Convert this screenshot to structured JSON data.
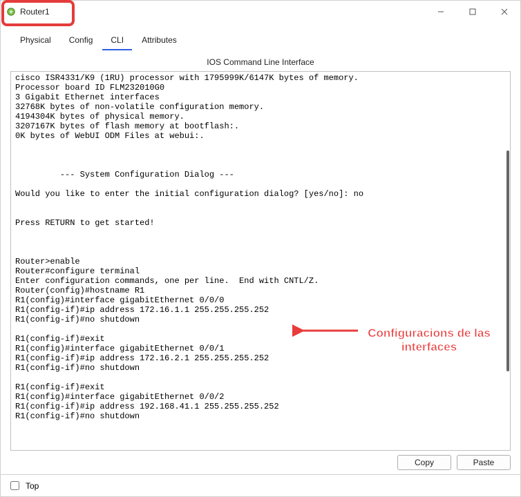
{
  "window": {
    "title": "Router1"
  },
  "tabs": {
    "items": [
      {
        "label": "Physical"
      },
      {
        "label": "Config"
      },
      {
        "label": "CLI"
      },
      {
        "label": "Attributes"
      }
    ],
    "activeIndex": 2
  },
  "panel": {
    "title": "IOS Command Line Interface"
  },
  "terminal": {
    "text": "cisco ISR4331/K9 (1RU) processor with 1795999K/6147K bytes of memory.\nProcessor board ID FLM232010G0\n3 Gigabit Ethernet interfaces\n32768K bytes of non-volatile configuration memory.\n4194304K bytes of physical memory.\n3207167K bytes of flash memory at bootflash:.\n0K bytes of WebUI ODM Files at webui:.\n\n\n\n         --- System Configuration Dialog ---\n\nWould you like to enter the initial configuration dialog? [yes/no]: no\n\n\nPress RETURN to get started!\n\n\n\nRouter>enable\nRouter#configure terminal\nEnter configuration commands, one per line.  End with CNTL/Z.\nRouter(config)#hostname R1\nR1(config)#interface gigabitEthernet 0/0/0\nR1(config-if)#ip address 172.16.1.1 255.255.255.252\nR1(config-if)#no shutdown\n\nR1(config-if)#exit\nR1(config)#interface gigabitEthernet 0/0/1\nR1(config-if)#ip address 172.16.2.1 255.255.255.252\nR1(config-if)#no shutdown\n\nR1(config-if)#exit\nR1(config)#interface gigabitEthernet 0/0/2\nR1(config-if)#ip address 192.168.41.1 255.255.255.252\nR1(config-if)#no shutdown"
  },
  "buttons": {
    "copy": "Copy",
    "paste": "Paste"
  },
  "bottom": {
    "top_label": "Top"
  },
  "annotation": {
    "text": "Configuracions de las interfaces"
  }
}
